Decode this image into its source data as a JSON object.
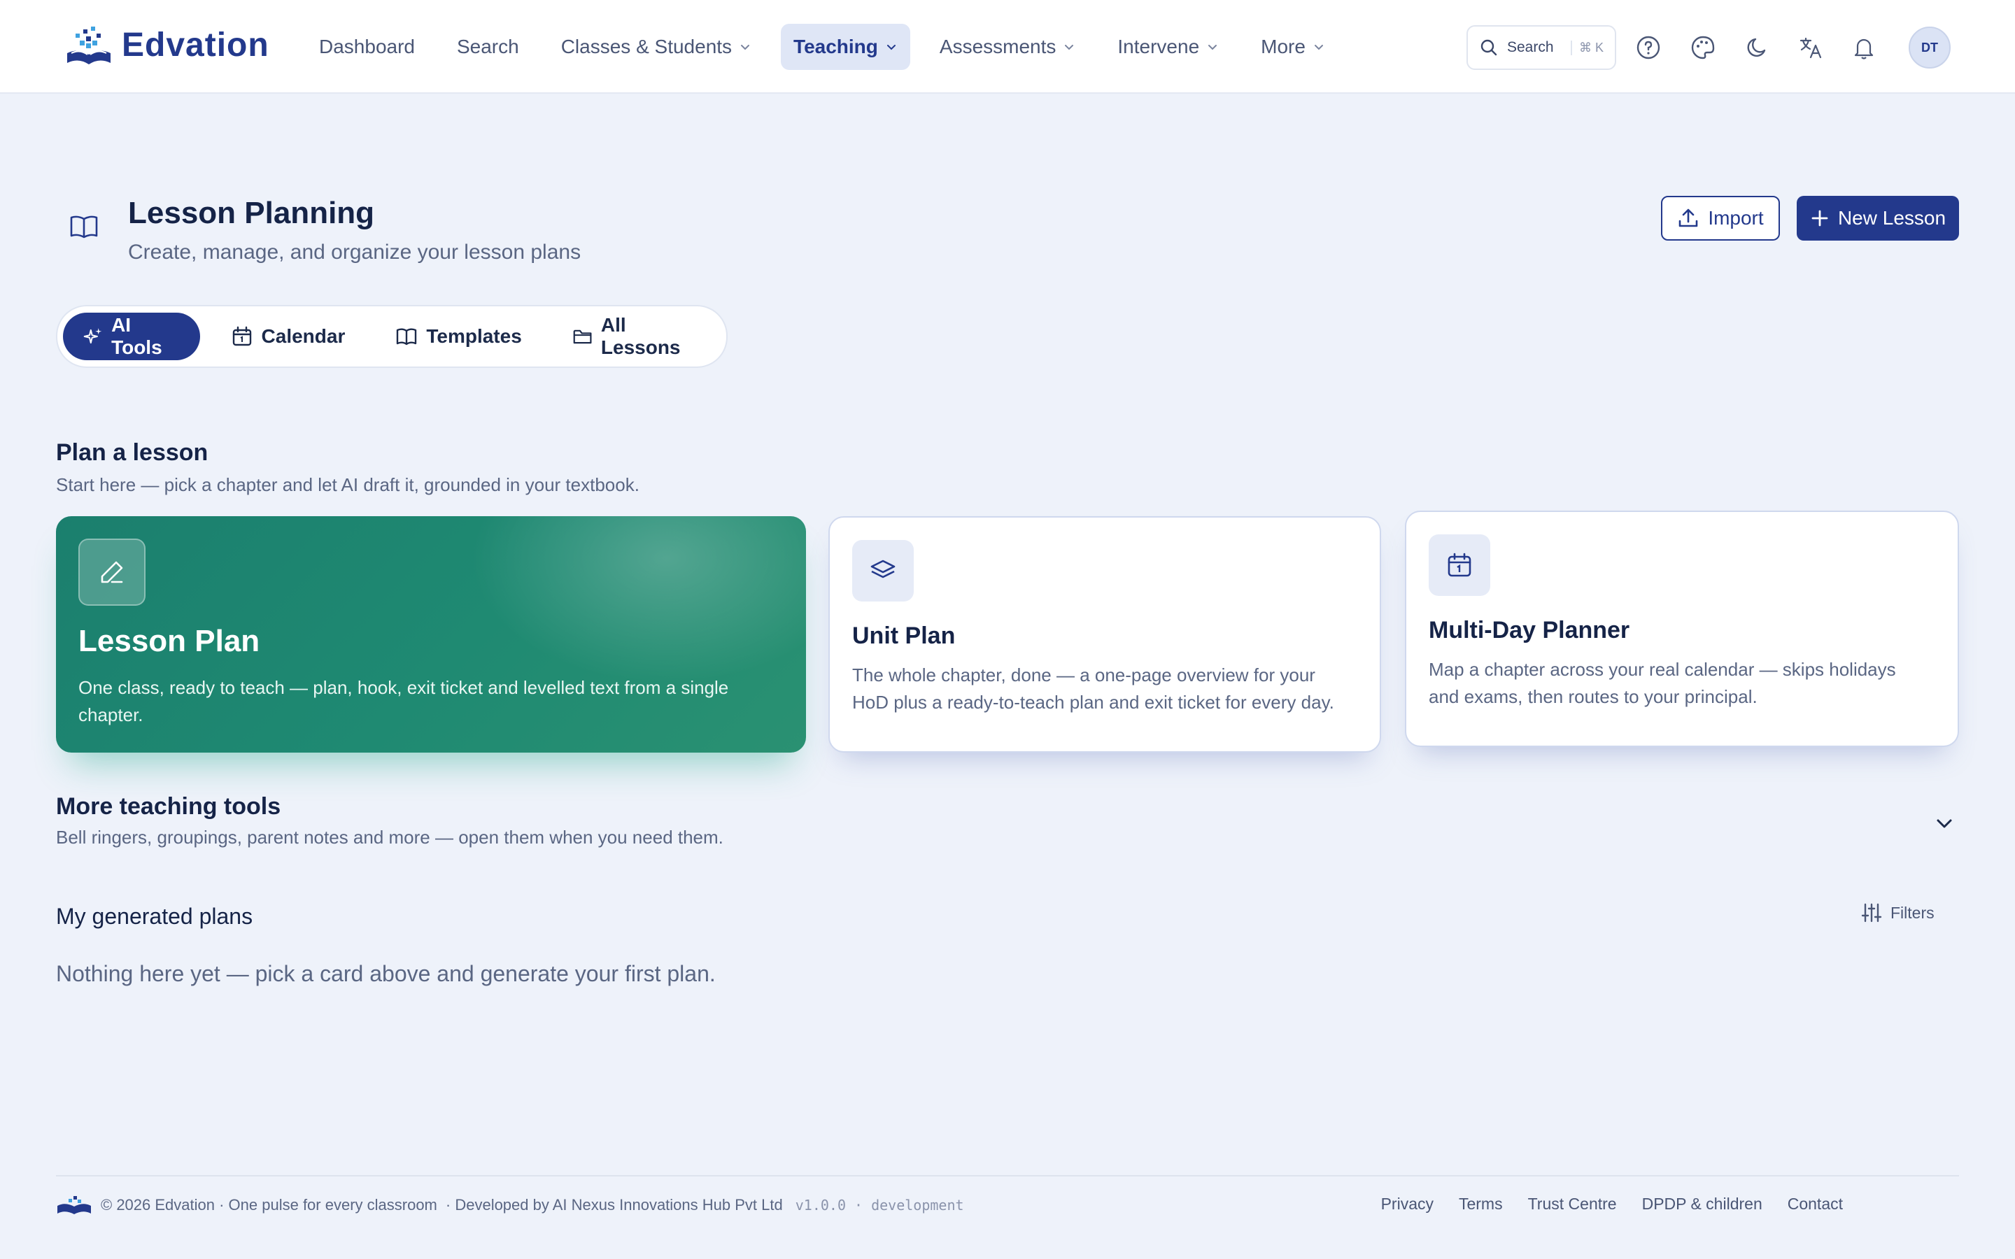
{
  "brand": {
    "name": "Edvation"
  },
  "nav": {
    "items": [
      {
        "label": "Dashboard",
        "dropdown": false,
        "active": false
      },
      {
        "label": "Search",
        "dropdown": false,
        "active": false
      },
      {
        "label": "Classes & Students",
        "dropdown": true,
        "active": false
      },
      {
        "label": "Teaching",
        "dropdown": true,
        "active": true
      },
      {
        "label": "Assessments",
        "dropdown": true,
        "active": false
      },
      {
        "label": "Intervene",
        "dropdown": true,
        "active": false
      },
      {
        "label": "More",
        "dropdown": true,
        "active": false
      }
    ],
    "search_label": "Search",
    "search_shortcut": "⌘ K",
    "avatar_initials": "DT"
  },
  "page": {
    "title": "Lesson Planning",
    "subtitle": "Create, manage, and organize your lesson plans",
    "import_label": "Import",
    "new_lesson_label": "New Lesson"
  },
  "tabs": [
    {
      "label": "AI Tools",
      "icon": "sparkles-icon",
      "active": true
    },
    {
      "label": "Calendar",
      "icon": "calendar-icon",
      "active": false
    },
    {
      "label": "Templates",
      "icon": "book-icon",
      "active": false
    },
    {
      "label": "All Lessons",
      "icon": "folder-icon",
      "active": false
    }
  ],
  "plan_section": {
    "title": "Plan a lesson",
    "desc": "Start here — pick a chapter and let AI draft it, grounded in your textbook.",
    "cards": [
      {
        "title": "Lesson Plan",
        "desc": "One class, ready to teach — plan, hook, exit ticket and levelled text from a single chapter.",
        "icon": "pencil-icon"
      },
      {
        "title": "Unit Plan",
        "desc": "The whole chapter, done — a one-page overview for your HoD plus a ready-to-teach plan and exit ticket for every day.",
        "icon": "layers-icon"
      },
      {
        "title": "Multi-Day Planner",
        "desc": "Map a chapter across your real calendar — skips holidays and exams, then routes to your principal.",
        "icon": "calendar-icon"
      }
    ]
  },
  "more_tools": {
    "title": "More teaching tools",
    "desc": "Bell ringers, groupings, parent notes and more — open them when you need them."
  },
  "generated": {
    "title": "My generated plans",
    "filters_label": "Filters",
    "empty_text": "Nothing here yet — pick a card above and generate your first plan."
  },
  "footer": {
    "copyright": "© 2026 Edvation · One pulse for every classroom",
    "developer": "· Developed by AI Nexus Innovations Hub Pvt Ltd",
    "version": "v1.0.0 · development",
    "links": [
      "Privacy",
      "Terms",
      "Trust Centre",
      "DPDP & children",
      "Contact"
    ]
  },
  "colors": {
    "primary": "#23398c",
    "hero_green": "#1f8a72",
    "background": "#eef2fa"
  }
}
